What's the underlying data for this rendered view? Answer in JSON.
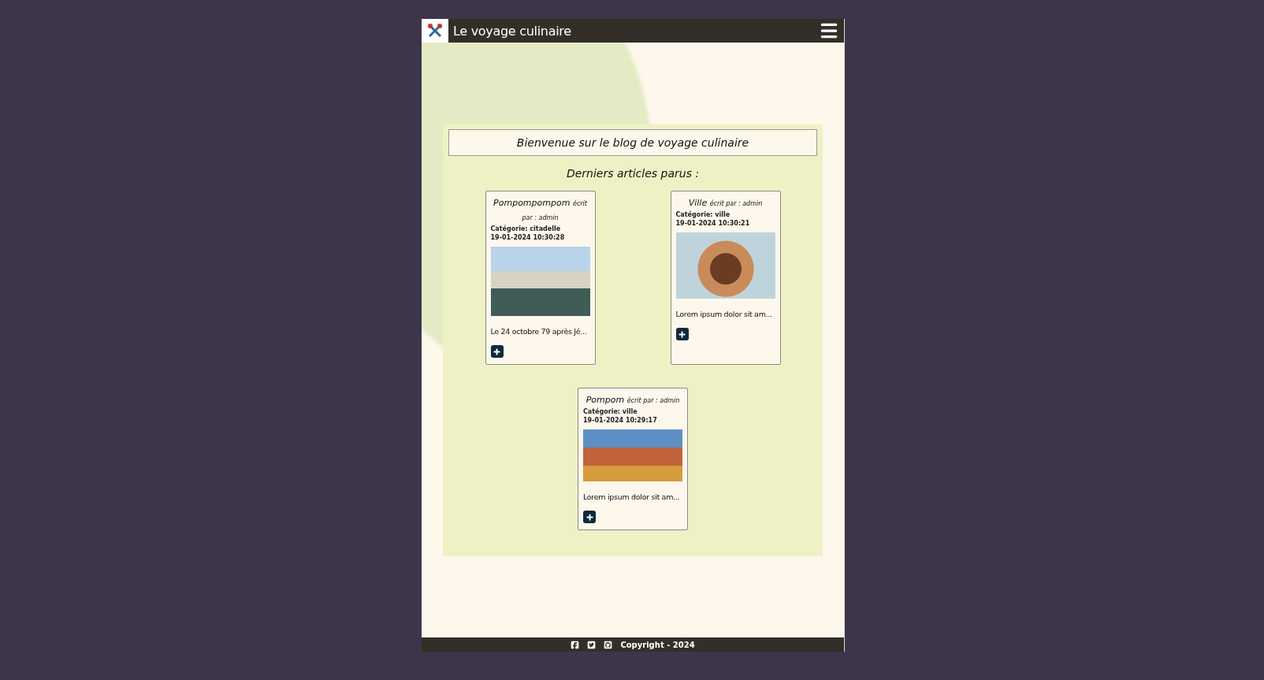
{
  "header": {
    "title": "Le voyage culinaire"
  },
  "welcome": "Bienvenue sur le blog de voyage culinaire",
  "section_title": "Derniers articles parus :",
  "articles": [
    {
      "title": "Pompompompom",
      "byline": "écrit par : admin",
      "category": "Catégorie: citadelle",
      "date": "19-01-2024 10:30:28",
      "excerpt": "Le 24 octobre 79 après Jé..."
    },
    {
      "title": "Ville",
      "byline": "écrit par : admin",
      "category": "Catégorie: ville",
      "date": "19-01-2024 10:30:21",
      "excerpt": "Lorem ipsum dolor sit am..."
    },
    {
      "title": "Pompom",
      "byline": "écrit par : admin",
      "category": "Catégorie: ville",
      "date": "19-01-2024 10:29:17",
      "excerpt": "Lorem ipsum dolor sit am..."
    }
  ],
  "footer": {
    "copyright": "Copyright - 2024"
  }
}
